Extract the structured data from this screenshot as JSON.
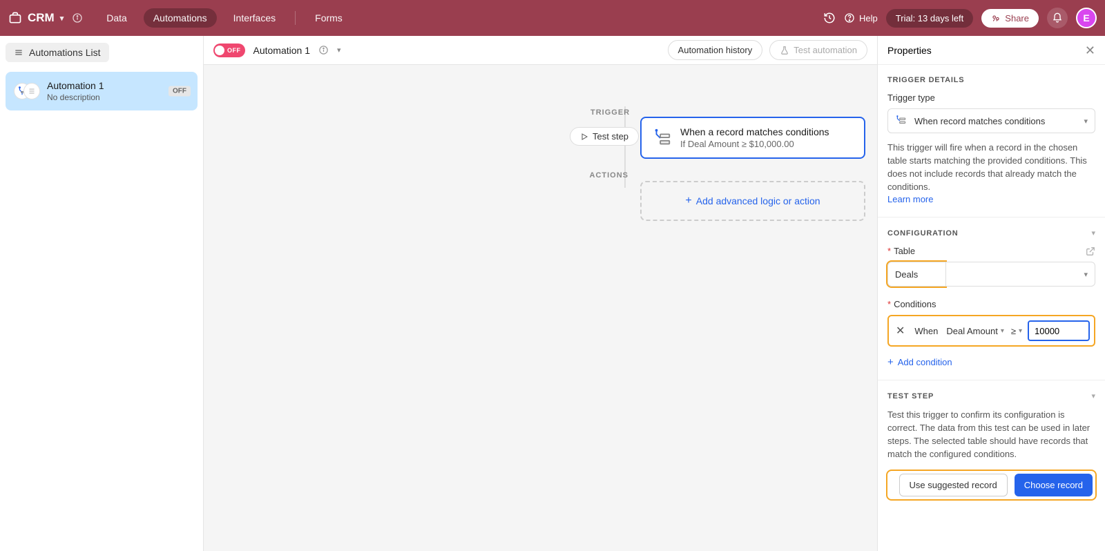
{
  "topbar": {
    "app_name": "CRM",
    "nav": {
      "data": "Data",
      "automations": "Automations",
      "interfaces": "Interfaces",
      "forms": "Forms"
    },
    "help": "Help",
    "trial": "Trial: 13 days left",
    "share": "Share",
    "avatar_letter": "E"
  },
  "left": {
    "list_button": "Automations List",
    "card": {
      "title": "Automation 1",
      "desc": "No description",
      "badge": "OFF"
    }
  },
  "center": {
    "toggle_label": "OFF",
    "automation_name": "Automation 1",
    "history_btn": "Automation history",
    "test_btn": "Test automation",
    "labels": {
      "trigger": "TRIGGER",
      "actions": "ACTIONS"
    },
    "test_step": "Test step",
    "trigger_card": {
      "title": "When a record matches conditions",
      "sub": "If Deal Amount ≥ $10,000.00"
    },
    "add_action": "Add advanced logic or action"
  },
  "panel": {
    "title": "Properties",
    "trigger_details": {
      "heading": "TRIGGER DETAILS",
      "type_label": "Trigger type",
      "type_value": "When record matches conditions",
      "desc": "This trigger will fire when a record in the chosen table starts matching the provided conditions. This does not include records that already match the conditions.",
      "learn_more": "Learn more"
    },
    "configuration": {
      "heading": "CONFIGURATION",
      "table_label": "Table",
      "table_value": "Deals",
      "conditions_label": "Conditions",
      "when": "When",
      "field": "Deal Amount",
      "op": "≥",
      "value": "10000",
      "add_condition": "Add condition"
    },
    "test_step": {
      "heading": "TEST STEP",
      "desc": "Test this trigger to confirm its configuration is correct. The data from this test can be used in later steps. The selected table should have records that match the configured conditions.",
      "use_suggested": "Use suggested record",
      "choose_record": "Choose record"
    }
  }
}
